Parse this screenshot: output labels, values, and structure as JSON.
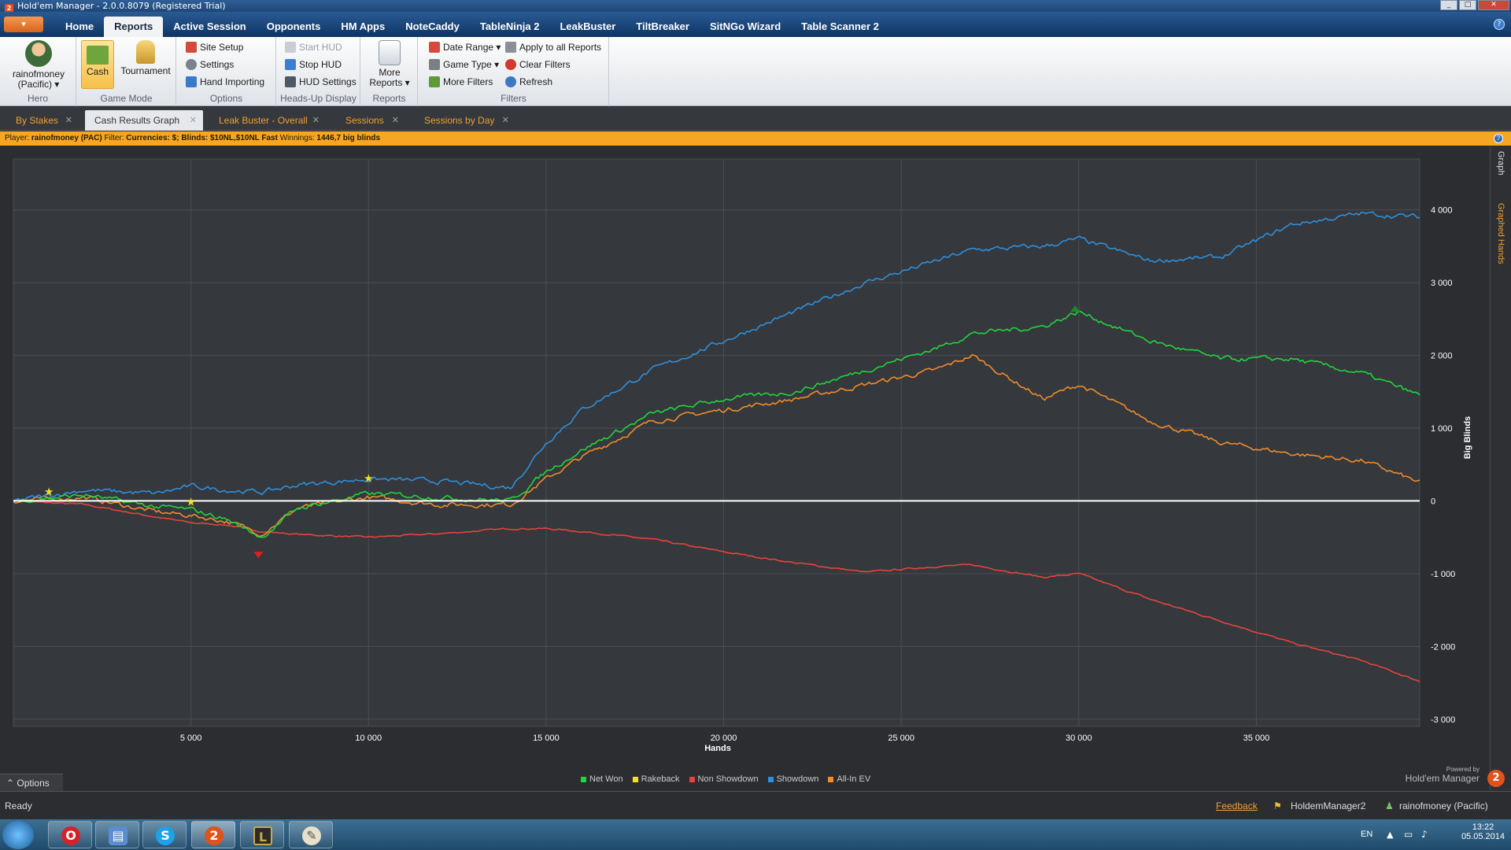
{
  "window": {
    "title": "Hold'em Manager - 2.0.0.8079 (Registered Trial)"
  },
  "menu": {
    "app_button": "▾",
    "items": [
      "Home",
      "Reports",
      "Active Session",
      "Opponents",
      "HM Apps",
      "NoteCaddy",
      "TableNinja 2",
      "LeakBuster",
      "TiltBreaker",
      "SitNGo Wizard",
      "Table Scanner 2"
    ],
    "active": "Reports"
  },
  "ribbon": {
    "hero": {
      "name": "rainofmoney",
      "site": "(Pacific) ▾",
      "label": "Hero"
    },
    "game_mode": {
      "cash": "Cash",
      "tournament": "Tournament",
      "label": "Game Mode"
    },
    "options": {
      "site_setup": "Site Setup",
      "settings": "Settings",
      "hand_importing": "Hand Importing",
      "label": "Options"
    },
    "hud": {
      "start": "Start HUD",
      "stop": "Stop HUD",
      "settings": "HUD Settings",
      "label": "Heads-Up Display"
    },
    "reports": {
      "more1": "More",
      "more2": "Reports ▾",
      "label": "Reports"
    },
    "filters": {
      "date_range": "Date Range ▾",
      "game_type": "Game Type ▾",
      "more_filters": "More Filters",
      "apply_all": "Apply to all Reports",
      "clear": "Clear Filters",
      "refresh": "Refresh",
      "label": "Filters"
    }
  },
  "tabs": [
    {
      "label": "By Stakes"
    },
    {
      "label": "Cash Results Graph",
      "active": true
    },
    {
      "label": "Leak Buster - Overall"
    },
    {
      "label": "Sessions"
    },
    {
      "label": "Sessions by Day"
    }
  ],
  "filterbar": {
    "player_label": "Player:",
    "player": "rainofmoney (PAC)",
    "filter_label": "Filter:",
    "filter": "Currencies: $; Blinds: $10NL,$10NL Fast",
    "winnings_label": "Winnings:",
    "winnings": "1446,7 big blinds"
  },
  "side_panel": {
    "graph": "Graph",
    "graphed_hands": "Graphed Hands"
  },
  "chart_data": {
    "type": "line",
    "xlabel": "Hands",
    "ylabel": "Big Blinds",
    "xlim": [
      0,
      39600
    ],
    "ylim": [
      -3100,
      4700
    ],
    "x_ticks": [
      5000,
      10000,
      15000,
      20000,
      25000,
      30000,
      35000
    ],
    "x_tick_labels": [
      "5 000",
      "10 000",
      "15 000",
      "20 000",
      "25 000",
      "30 000",
      "35 000"
    ],
    "y_ticks": [
      4000,
      3000,
      2000,
      1000,
      0,
      -1000,
      -2000,
      -3000
    ],
    "y_tick_labels": [
      "4 000",
      "3 000",
      "2 000",
      "1 000",
      "0",
      "-1 000",
      "-2 000",
      "-3 000"
    ],
    "grid": true,
    "legend_position": "bottom",
    "x": [
      0,
      2000,
      4000,
      5000,
      6000,
      7000,
      8000,
      10000,
      12000,
      14000,
      15000,
      16000,
      18000,
      20000,
      22000,
      24000,
      26000,
      27000,
      29000,
      30000,
      32000,
      34000,
      36000,
      38000,
      39600
    ],
    "series": [
      {
        "name": "Net Won",
        "color": "#22d43f",
        "values": [
          0,
          80,
          -80,
          -120,
          -250,
          -500,
          -100,
          100,
          50,
          0,
          400,
          700,
          1200,
          1400,
          1500,
          1800,
          2100,
          2300,
          2400,
          2600,
          2200,
          1950,
          1950,
          1750,
          1450
        ]
      },
      {
        "name": "Rakeback",
        "color": "#f4e020",
        "values": [
          0,
          0,
          0,
          0,
          0,
          0,
          0,
          0,
          0,
          0,
          0,
          0,
          0,
          0,
          0,
          0,
          0,
          0,
          0,
          0,
          0,
          0,
          0,
          0,
          0
        ]
      },
      {
        "name": "Non Showdown",
        "color": "#e5443c",
        "values": [
          0,
          -50,
          -220,
          -300,
          -330,
          -420,
          -460,
          -500,
          -450,
          -380,
          -380,
          -420,
          -530,
          -700,
          -850,
          -980,
          -900,
          -880,
          -1050,
          -1000,
          -1350,
          -1650,
          -1950,
          -2200,
          -2480
        ]
      },
      {
        "name": "Showdown",
        "color": "#2f8fdc",
        "values": [
          0,
          150,
          100,
          200,
          150,
          120,
          220,
          300,
          270,
          180,
          800,
          1250,
          1800,
          2200,
          2600,
          3000,
          3300,
          3450,
          3500,
          3600,
          3300,
          3350,
          3800,
          3950,
          3900
        ]
      },
      {
        "name": "All-In EV",
        "color": "#f08c2c",
        "values": [
          0,
          50,
          -150,
          -200,
          -280,
          -450,
          -100,
          50,
          -50,
          -50,
          300,
          600,
          1100,
          1250,
          1400,
          1600,
          1800,
          2000,
          1400,
          1600,
          1100,
          800,
          650,
          550,
          250
        ]
      }
    ]
  },
  "options_bar": "⌃ Options",
  "powered": {
    "line1": "Powered by",
    "line2": "Hold'em Manager",
    "logo": "2"
  },
  "status": {
    "ready": "Ready",
    "feedback": "Feedback",
    "app": "HoldemManager2",
    "user": "rainofmoney (Pacific)"
  },
  "taskbar": {
    "lang": "EN",
    "time": "13:22",
    "date": "05.05.2014"
  }
}
